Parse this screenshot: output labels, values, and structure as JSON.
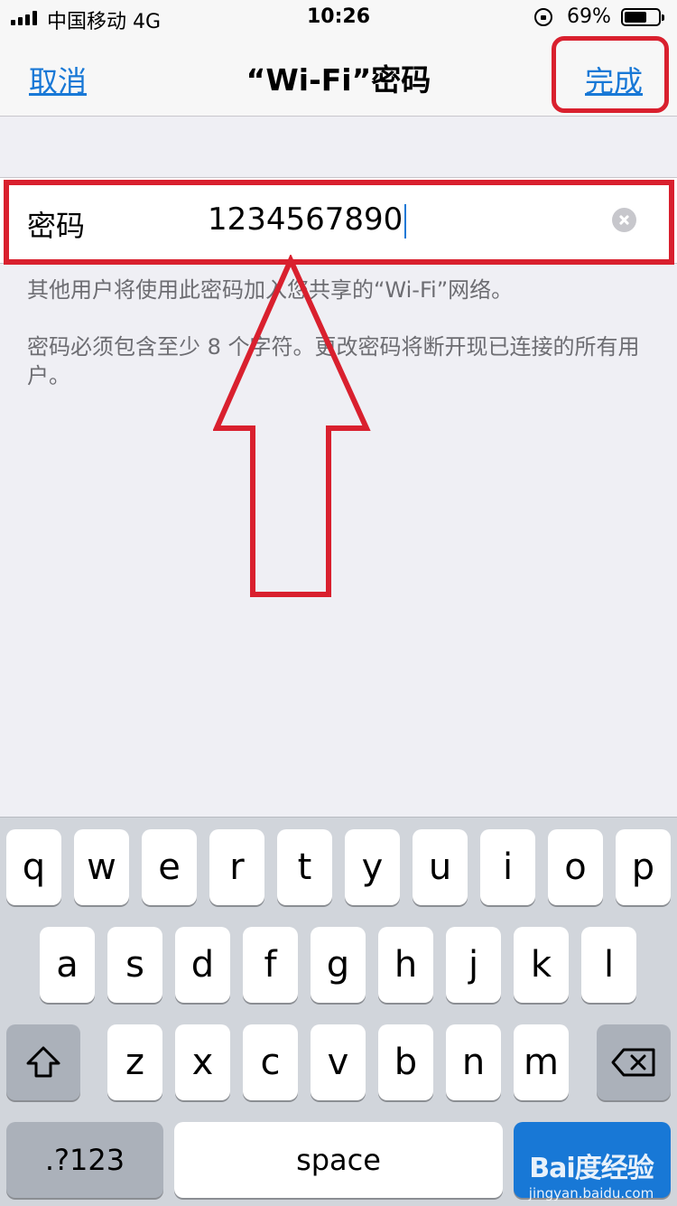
{
  "status_bar": {
    "carrier": "中国移动   4G",
    "time": "10:26",
    "battery_percent": "69%",
    "battery_level": 0.69
  },
  "nav": {
    "cancel_label": "取消",
    "title": "“Wi-Fi”密码",
    "done_label": "完成"
  },
  "password_field": {
    "label": "密码",
    "value": "1234567890"
  },
  "help": {
    "line1": "其他用户将使用此密码加入您共享的“Wi-Fi”网络。",
    "line2": "密码必须包含至少 8 个字符。更改密码将断开现已连接的所有用户。"
  },
  "keyboard": {
    "row1": [
      "q",
      "w",
      "e",
      "r",
      "t",
      "y",
      "u",
      "i",
      "o",
      "p"
    ],
    "row2": [
      "a",
      "s",
      "d",
      "f",
      "g",
      "h",
      "j",
      "k",
      "l"
    ],
    "row3": [
      "z",
      "x",
      "c",
      "v",
      "b",
      "n",
      "m"
    ],
    "numbers_label": ".?123",
    "space_label": "space"
  },
  "watermark": {
    "main": "Bai度经验",
    "url": "jingyan.baidu.com"
  },
  "colors": {
    "accent": "#1878d6",
    "annotation": "#d9202e",
    "background": "#efeff4"
  },
  "icons": {
    "shift": "shift-arrow-icon",
    "delete": "backspace-icon",
    "clear": "clear-circle-icon"
  }
}
